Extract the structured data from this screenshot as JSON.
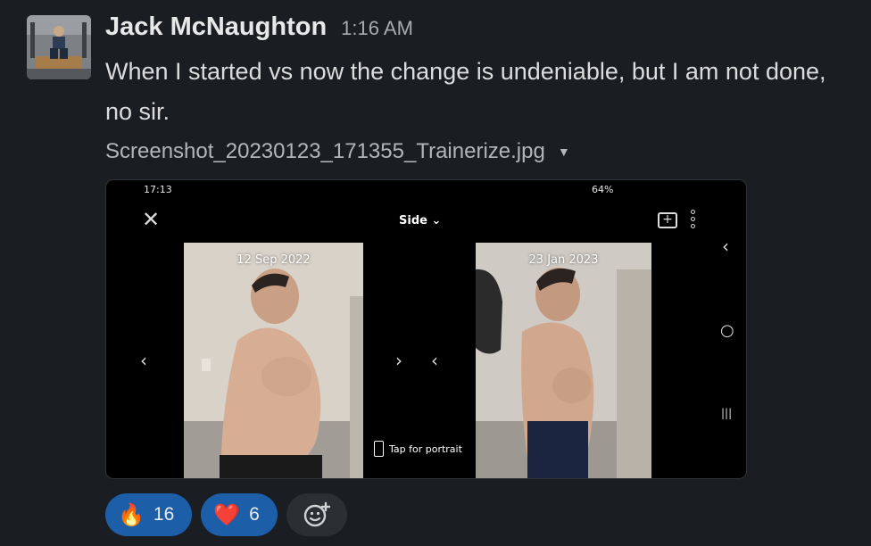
{
  "message": {
    "author": "Jack McNaughton",
    "timestamp": "1:16 AM",
    "text": "When I started vs now the change is undeniable, but I am not done, no sir."
  },
  "attachment": {
    "file_name": "Screenshot_20230123_171355_Trainerize.jpg",
    "caret": "▼",
    "screenshot": {
      "status_time": "17:13",
      "status_right": "64%",
      "close": "✕",
      "view_selector": "Side ⌄",
      "comment_icon": "+",
      "photos": [
        {
          "date": "12 Sep 2022"
        },
        {
          "date": "23 Jan 2023"
        }
      ],
      "nav_prev": "‹",
      "nav_next": "›",
      "tap_for_portrait": "Tap for portrait",
      "sys_back": "‹",
      "sys_home": "○",
      "sys_recent": "|||"
    }
  },
  "reactions": [
    {
      "emoji": "🔥",
      "count": "16"
    },
    {
      "emoji": "❤️",
      "count": "6"
    }
  ],
  "colors": {
    "background": "#1a1d21",
    "reaction_active": "#1d5ea8",
    "add_reaction_bg": "#2b2e32"
  }
}
